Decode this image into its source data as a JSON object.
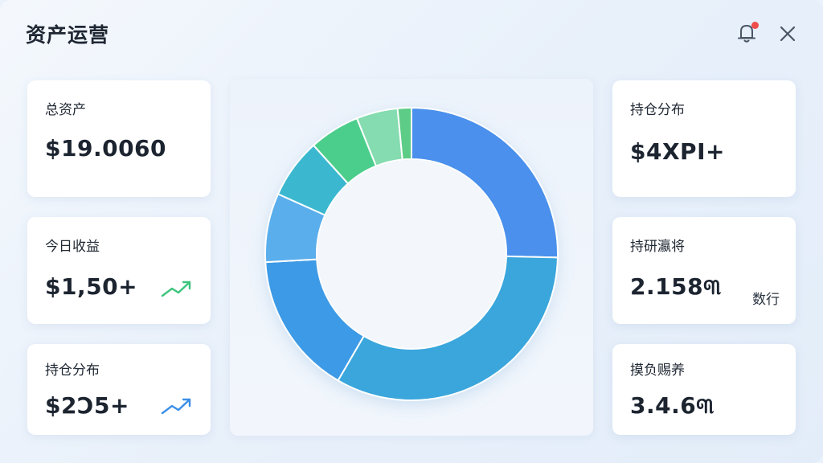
{
  "window": {
    "title": "资产运营"
  },
  "header": {
    "notification_icon": "bell-icon",
    "notification_badge_color": "#ef4b4b",
    "close_icon": "close-icon"
  },
  "left_cards": [
    {
      "label": "总资产",
      "value": "$19.0060"
    },
    {
      "label": "今日收益",
      "value": "$1,50+",
      "trend_icon": "trend-up-icon",
      "trend_color": "#3cc47c"
    },
    {
      "label": "持仓分布",
      "value": "$2Ɔ5+",
      "trend_icon": "trend-up-icon",
      "trend_color": "#3b8fe8"
    }
  ],
  "right_cards": [
    {
      "label": "持仓分布",
      "value": "$4XPI+"
    },
    {
      "label": "持研瀛将",
      "value": "2.158୩",
      "side_text": "数行"
    },
    {
      "label": "摸负赐养",
      "value": "3.4.6୩"
    }
  ],
  "chart_data": {
    "type": "pie",
    "donut": true,
    "title": "",
    "slices": [
      {
        "value": 25.0,
        "color": "#4a90ec"
      },
      {
        "value": 32.5,
        "color": "#3aa6dc"
      },
      {
        "value": 15.5,
        "color": "#3d9ae6"
      },
      {
        "value": 7.5,
        "color": "#5aaeec"
      },
      {
        "value": 6.5,
        "color": "#3bb8d0"
      },
      {
        "value": 5.5,
        "color": "#4bce8c"
      },
      {
        "value": 4.5,
        "color": "#84dcb0"
      },
      {
        "value": 1.5,
        "color": "#5dcc86"
      }
    ]
  }
}
